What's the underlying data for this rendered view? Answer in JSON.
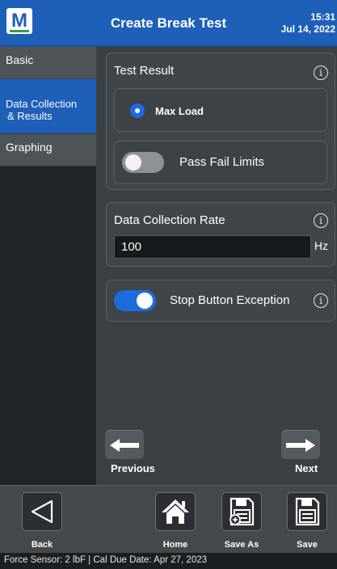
{
  "header": {
    "logo_letter": "M",
    "title": "Create Break Test",
    "time": "15:31",
    "date": "Jul 14, 2022"
  },
  "sidebar": {
    "items": [
      {
        "label": "Basic"
      },
      {
        "label_line1": "Data Collection",
        "label_line2": "& Results"
      },
      {
        "label": "Graphing"
      }
    ]
  },
  "test_result": {
    "title": "Test Result",
    "option_label": "Max Load",
    "toggle_label": "Pass Fail Limits",
    "toggle_on": false
  },
  "data_collection": {
    "title": "Data Collection Rate",
    "value": "100",
    "unit": "Hz"
  },
  "stop_button": {
    "label": "Stop Button Exception",
    "toggle_on": true
  },
  "nav": {
    "previous_label": "Previous",
    "next_label": "Next"
  },
  "toolbar": {
    "back_label": "Back",
    "home_label": "Home",
    "save_as_label": "Save As",
    "save_label": "Save"
  },
  "status": {
    "text": "Force Sensor: 2 lbF  |  Cal Due Date: Apr 27, 2023"
  },
  "icons": {
    "info": "info-icon",
    "back": "triangle-left-icon",
    "home": "home-icon",
    "save_as": "floppy-plus-icon",
    "save": "floppy-icon"
  },
  "colors": {
    "accent": "#1e5fb8",
    "toggle_on": "#1e6be0"
  }
}
